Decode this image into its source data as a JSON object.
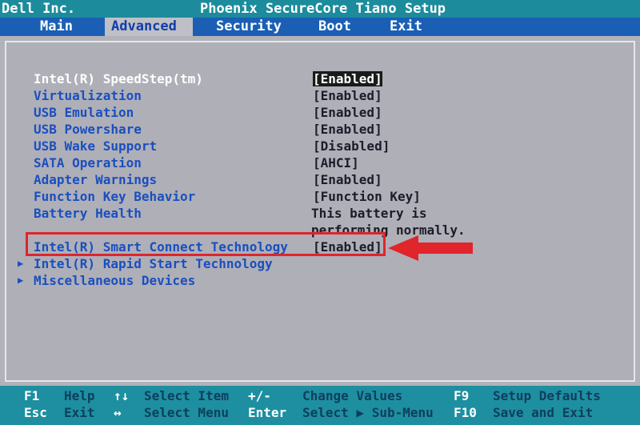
{
  "titlebar": {
    "vendor": "Dell Inc.",
    "title": "Phoenix SecureCore Tiano Setup"
  },
  "tabs": [
    {
      "label": "Main"
    },
    {
      "label": "Advanced"
    },
    {
      "label": "Security"
    },
    {
      "label": "Boot"
    },
    {
      "label": "Exit"
    }
  ],
  "settings": [
    {
      "label": "Intel(R) SpeedStep(tm)",
      "value": "[Enabled]"
    },
    {
      "label": "Virtualization",
      "value": "[Enabled]"
    },
    {
      "label": "USB Emulation",
      "value": "[Enabled]"
    },
    {
      "label": "USB Powershare",
      "value": "[Enabled]"
    },
    {
      "label": "USB Wake Support",
      "value": "[Disabled]"
    },
    {
      "label": "SATA Operation",
      "value": "[AHCI]"
    },
    {
      "label": "Adapter Warnings",
      "value": "[Enabled]"
    },
    {
      "label": "Function Key Behavior",
      "value": "[Function Key]"
    },
    {
      "label": "Battery Health",
      "value": ""
    },
    {
      "label": "Intel(R) Smart Connect Technology",
      "value": "[Enabled]"
    }
  ],
  "battery_note_1": "This battery is",
  "battery_note_2": "performing normally.",
  "submenus": [
    {
      "label": "Intel(R) Rapid Start Technology"
    },
    {
      "label": "Miscellaneous Devices"
    }
  ],
  "submenu_arrow": "▶",
  "footer": {
    "f1_key": "F1",
    "f1_desc": "Help",
    "esc_key": "Esc",
    "esc_desc": "Exit",
    "updown_key": "↑↓",
    "updown_desc": "Select Item",
    "leftright_key": "↔",
    "leftright_desc": "Select Menu",
    "plusminus_key": "+/-",
    "plusminus_desc": "Change Values",
    "enter_key": "Enter",
    "enter_desc": "Select ▶ Sub-Menu",
    "f9_key": "F9",
    "f9_desc": "Setup Defaults",
    "f10_key": "F10",
    "f10_desc": "Save and Exit"
  },
  "colors": {
    "highlight_border": "#e0252b",
    "label_blue": "#1a4fbf",
    "panel_gray": "#afafb8",
    "menubar_blue": "#1a5fb4",
    "footer_teal": "#1d8fa0"
  }
}
